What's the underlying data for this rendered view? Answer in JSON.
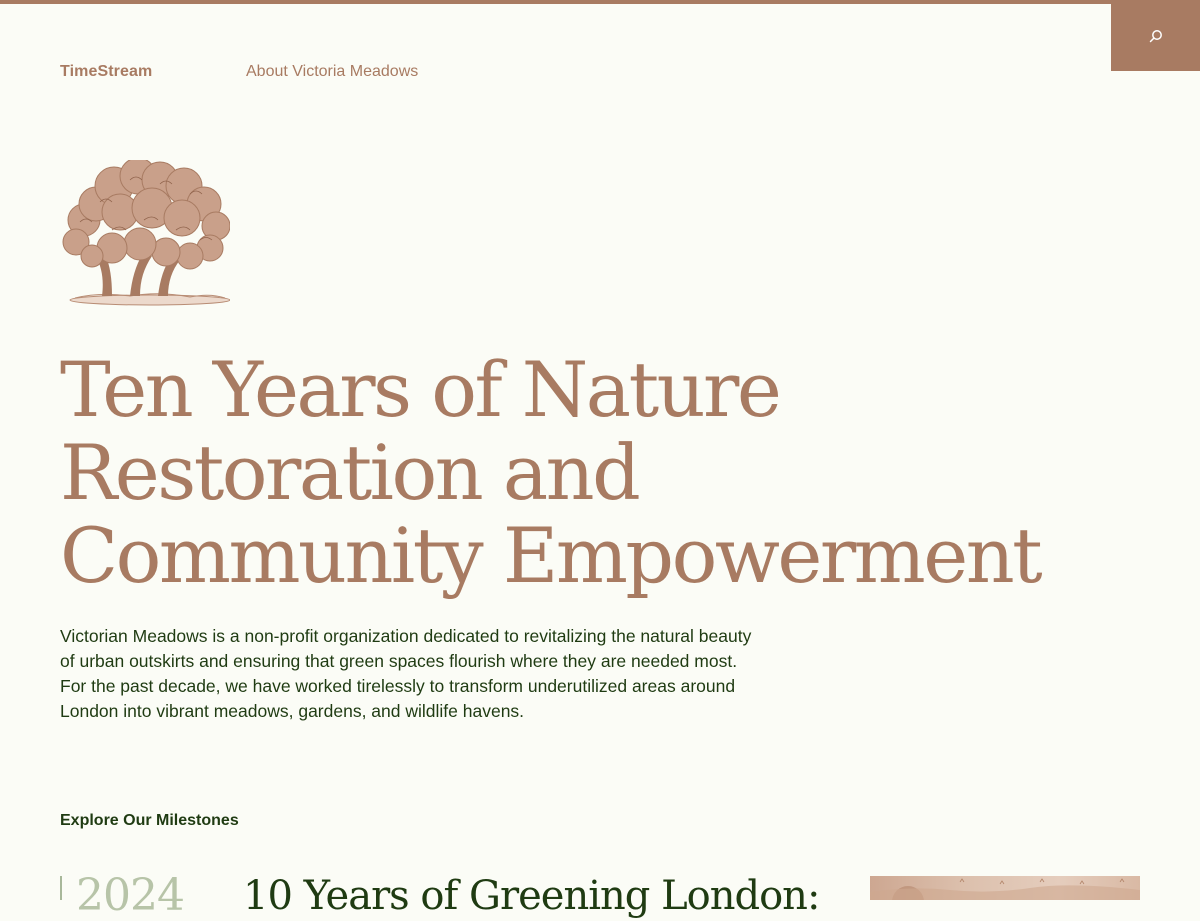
{
  "header": {
    "brand": "TimeStream",
    "nav_items": [
      {
        "label": "About Victoria Meadows"
      }
    ],
    "search_icon": "search-icon"
  },
  "hero": {
    "illustration_icon": "tree-illustration",
    "title": "Ten Years of Nature Restoration and Community Empowerment",
    "description": "Victorian Meadows is a non-profit organization dedicated to revitalizing the natural beauty of urban outskirts and ensuring that green spaces flourish where they are needed most. For the past decade, we have worked tirelessly to transform underutilized areas around London into vibrant meadows, gardens, and wildlife havens."
  },
  "milestones": {
    "heading": "Explore Our Milestones",
    "items": [
      {
        "year": "2024",
        "title": "10 Years of Greening London:"
      }
    ]
  },
  "colors": {
    "accent": "#a87b62",
    "text": "#1f3b12",
    "background": "#fbfcf6",
    "muted": "#b7c4a8"
  }
}
